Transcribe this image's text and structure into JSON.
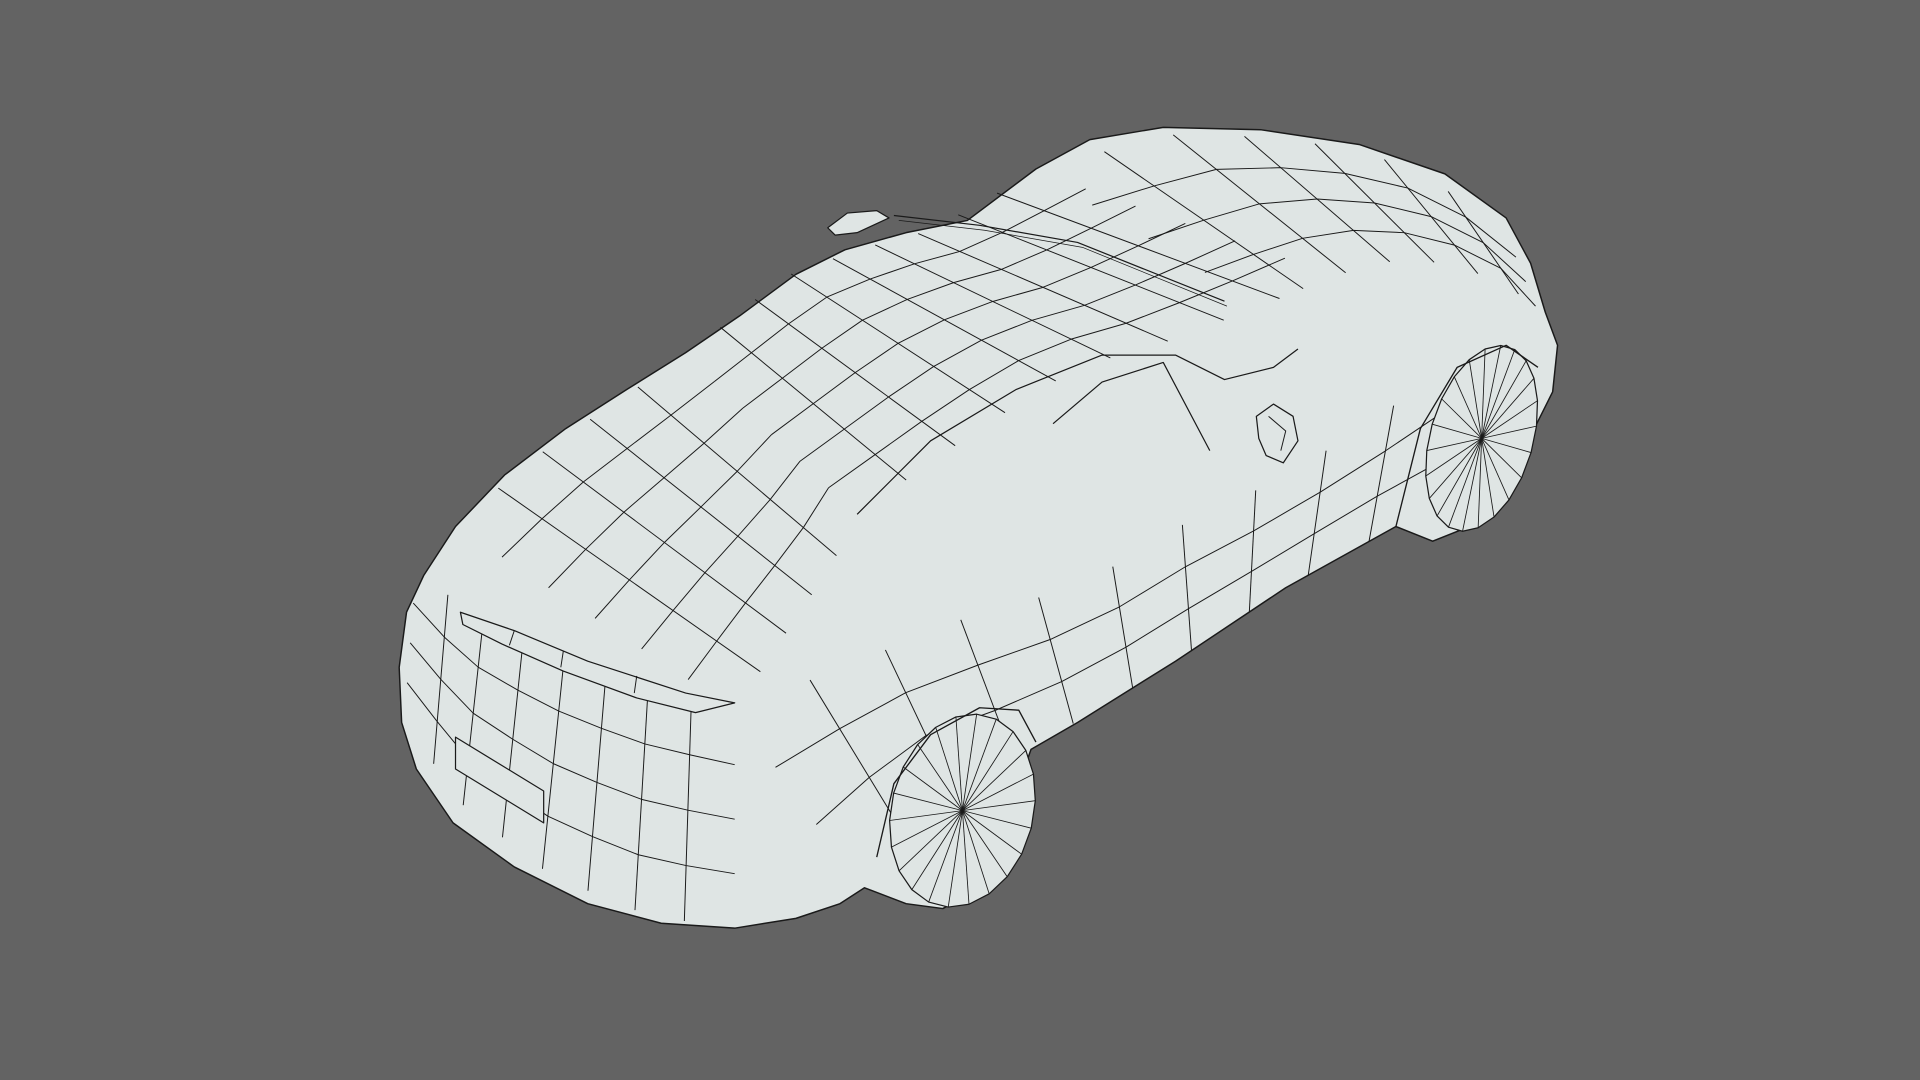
{
  "viewport": {
    "background_color": "#636363",
    "mesh_fill_color": "#dfe5e4",
    "wire_color": "#1a1a1a",
    "display_mode": "wireframe-on-shaded",
    "subject": "sports-car-mesh"
  }
}
